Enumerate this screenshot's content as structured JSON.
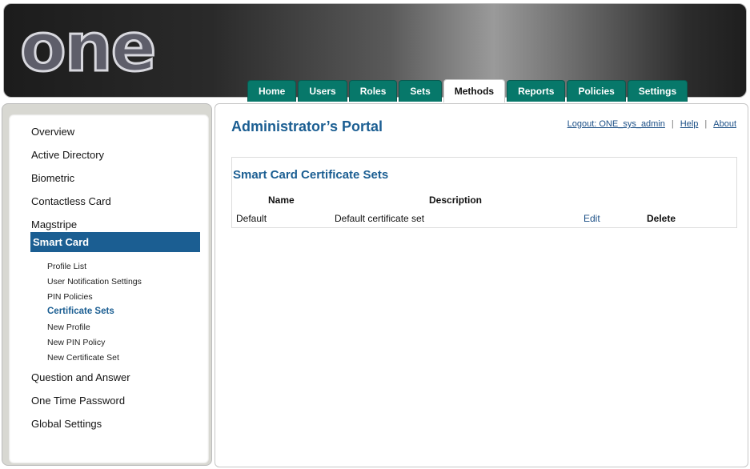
{
  "header": {
    "logo_text": "one"
  },
  "tabs": [
    {
      "label": "Home"
    },
    {
      "label": "Users"
    },
    {
      "label": "Roles"
    },
    {
      "label": "Sets"
    },
    {
      "label": "Methods",
      "active": true
    },
    {
      "label": "Reports"
    },
    {
      "label": "Policies"
    },
    {
      "label": "Settings"
    }
  ],
  "sidebar": {
    "items": [
      {
        "label": "Overview"
      },
      {
        "label": "Active Directory"
      },
      {
        "label": "Biometric"
      },
      {
        "label": "Contactless Card"
      },
      {
        "label": "Magstripe"
      },
      {
        "label": "Smart Card",
        "active": true
      },
      {
        "label": "Question and Answer"
      },
      {
        "label": "One Time Password"
      },
      {
        "label": "Global Settings"
      }
    ],
    "sub_items": [
      {
        "label": "Profile List"
      },
      {
        "label": "User Notification Settings"
      },
      {
        "label": "PIN Policies"
      },
      {
        "label": "Certificate Sets",
        "current": true
      },
      {
        "label": "New Profile"
      },
      {
        "label": "New PIN Policy"
      },
      {
        "label": "New Certificate Set"
      }
    ]
  },
  "main": {
    "title": "Administrator’s Portal",
    "links": {
      "logout": "Logout: ONE_sys_admin",
      "help": "Help",
      "about": "About",
      "separator": "|"
    },
    "section": {
      "title": "Smart Card Certificate Sets",
      "columns": [
        "Name",
        "Description"
      ],
      "rows": [
        {
          "name": "Default",
          "description": "Default certificate set",
          "edit": "Edit",
          "delete": "Delete"
        }
      ]
    }
  }
}
